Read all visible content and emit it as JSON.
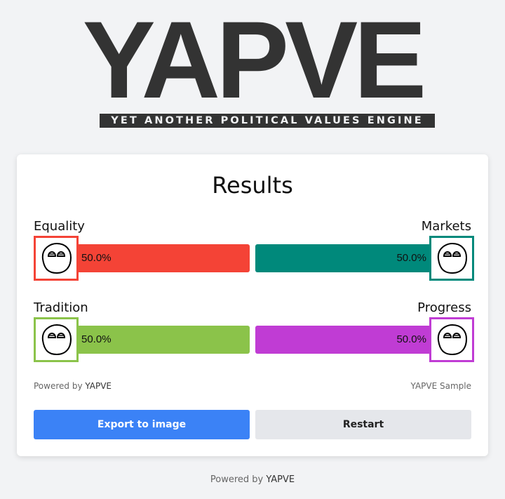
{
  "logo": {
    "word": "YAPVE",
    "tagline": "YET ANOTHER POLITICAL VALUES ENGINE"
  },
  "results": {
    "title": "Results",
    "axes": [
      {
        "left_label": "Equality",
        "left_value": "50.0%",
        "left_color": "#f44336",
        "right_label": "Markets",
        "right_value": "50.0%",
        "right_color": "#00897b",
        "left_fraction": 0.5
      },
      {
        "left_label": "Tradition",
        "left_value": "50.0%",
        "left_color": "#8bc34a",
        "right_label": "Progress",
        "right_value": "50.0%",
        "right_color": "#c03cd4",
        "left_fraction": 0.5
      }
    ],
    "icon": "polandball-face-icon",
    "footer_left_prefix": "Powered by ",
    "footer_left_brand": "YAPVE",
    "footer_right": "YAPVE Sample",
    "export_label": "Export to image",
    "restart_label": "Restart",
    "export_color": "#3b82f6",
    "restart_color": "#e5e7eb"
  },
  "page_footer": {
    "prefix": "Powered by ",
    "brand": "YAPVE"
  }
}
